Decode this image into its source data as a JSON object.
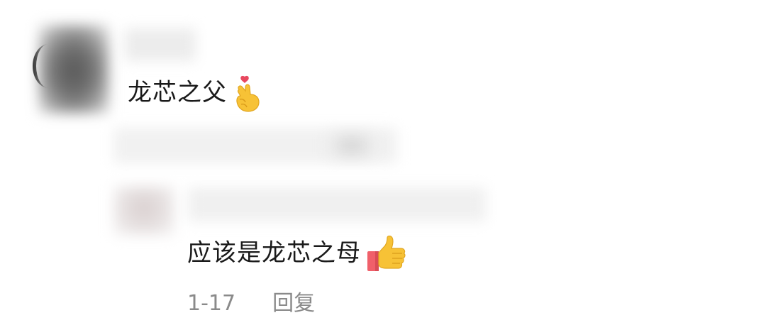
{
  "comment": {
    "text": "龙芯之父",
    "emoji": "finger-heart"
  },
  "reply": {
    "text": "应该是龙芯之母",
    "emoji": "thumbs-up",
    "date": "1-17",
    "reply_label": "回复"
  },
  "colors": {
    "text": "#1a1a1a",
    "meta_text": "#8a8a8a",
    "emoji_yellow": "#f7c236",
    "emoji_heart": "#e8485f",
    "emoji_sleeve": "#f0606a"
  }
}
